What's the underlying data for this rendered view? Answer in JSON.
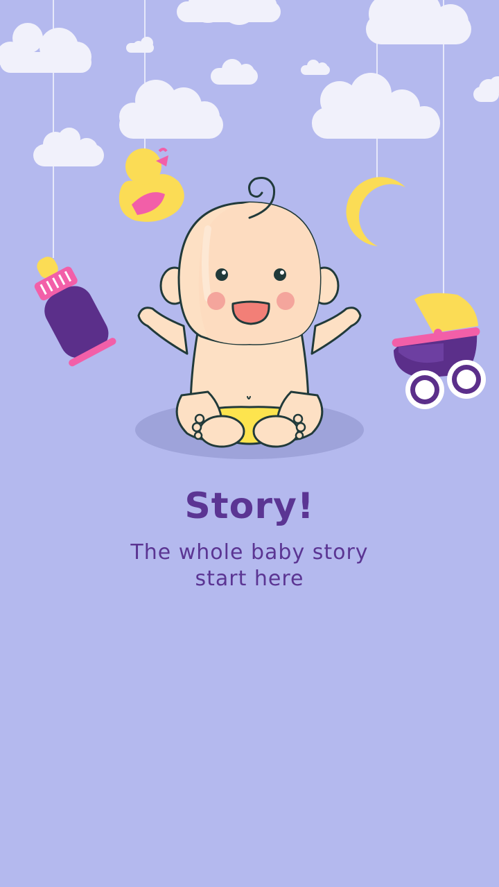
{
  "onboarding": {
    "title": "Story!",
    "subtitle": "The whole baby story start here"
  },
  "colors": {
    "background": "#b4b9ee",
    "accent_purple": "#5b3593",
    "pink": "#f25fa8",
    "yellow": "#fbdc55",
    "skin": "#fde0c4",
    "cloud": "#f1f1fb"
  },
  "illustration": {
    "hanging_items": [
      "bottle-icon",
      "duck-icon",
      "moon-icon",
      "stroller-icon"
    ],
    "character": "baby-illustration"
  }
}
